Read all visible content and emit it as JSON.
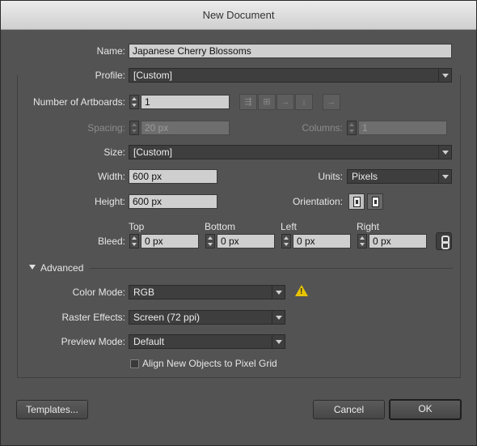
{
  "window": {
    "title": "New Document"
  },
  "name": {
    "label": "Name:",
    "value": "Japanese Cherry Blossoms"
  },
  "profile": {
    "label": "Profile:",
    "value": "[Custom]"
  },
  "artboards": {
    "label": "Number of Artboards:",
    "value": "1"
  },
  "spacing": {
    "label": "Spacing:",
    "value": "20 px"
  },
  "columns": {
    "label": "Columns:",
    "value": "1"
  },
  "size": {
    "label": "Size:",
    "value": "[Custom]"
  },
  "width": {
    "label": "Width:",
    "value": "600 px"
  },
  "units": {
    "label": "Units:",
    "value": "Pixels"
  },
  "height": {
    "label": "Height:",
    "value": "600 px"
  },
  "orientation": {
    "label": "Orientation:"
  },
  "bleed": {
    "label": "Bleed:",
    "top": {
      "label": "Top",
      "value": "0 px"
    },
    "bottom": {
      "label": "Bottom",
      "value": "0 px"
    },
    "left": {
      "label": "Left",
      "value": "0 px"
    },
    "right": {
      "label": "Right",
      "value": "0 px"
    }
  },
  "advanced": {
    "label": "Advanced"
  },
  "color_mode": {
    "label": "Color Mode:",
    "value": "RGB",
    "warning_icon": "warning-icon"
  },
  "raster_effects": {
    "label": "Raster Effects:",
    "value": "Screen (72 ppi)"
  },
  "preview_mode": {
    "label": "Preview Mode:",
    "value": "Default"
  },
  "align_pixel_grid": {
    "label": "Align New Objects to Pixel Grid",
    "checked": false
  },
  "buttons": {
    "templates": "Templates...",
    "cancel": "Cancel",
    "ok": "OK"
  },
  "colors": {
    "dialog_bg": "#535353",
    "warning": "#e8c400"
  }
}
